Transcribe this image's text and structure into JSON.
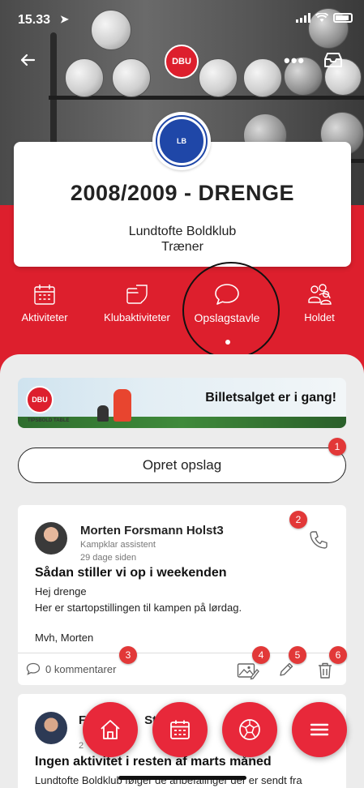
{
  "status_bar": {
    "time": "15.33"
  },
  "header": {
    "logo_text": "DBU"
  },
  "club": {
    "logo_text": "LB",
    "team_title": "2008/2009 - DRENGE",
    "club_name": "Lundtofte Boldklub",
    "role": "Træner"
  },
  "tabs": [
    {
      "label": "Aktiviteter",
      "icon": "calendar-icon"
    },
    {
      "label": "Klubaktiviteter",
      "icon": "shield-calendar-icon"
    },
    {
      "label": "Opslagstavle",
      "icon": "chat-bubble-icon",
      "active": true
    },
    {
      "label": "Holdet",
      "icon": "people-icon"
    }
  ],
  "banner": {
    "text": "Billetsalget er i gang!",
    "crest_text": "DBU",
    "sub_text": "TIPSBOLD TABLE"
  },
  "create_post": {
    "label": "Opret opslag"
  },
  "badges": [
    "1",
    "2",
    "3",
    "4",
    "5",
    "6"
  ],
  "posts": [
    {
      "author": "Morten Forsmann Holst3",
      "role": "Kampklar assistent",
      "ago": "29 dage siden",
      "title": "Sådan stiller vi op i weekenden",
      "body_line1": "Hej drenge",
      "body_line2": "Her er startopstillingen til kampen på lørdag.",
      "sign": "Mvh, Morten",
      "comments": "0 kommentarer"
    },
    {
      "author": "Ste",
      "ago": "2",
      "title": "Ingen aktivitet i resten af marts måned",
      "body": "Lundtofte Boldklub følger de anbefalinger der er sendt fra"
    }
  ],
  "fabs": [
    {
      "icon": "home-icon"
    },
    {
      "icon": "calendar-icon"
    },
    {
      "icon": "soccer-ball-icon"
    },
    {
      "icon": "menu-icon"
    }
  ],
  "colors": {
    "brand_red": "#dd1f2d",
    "fab_red": "#e8283a",
    "badge_red": "#e23838",
    "club_blue": "#1f47a8"
  }
}
